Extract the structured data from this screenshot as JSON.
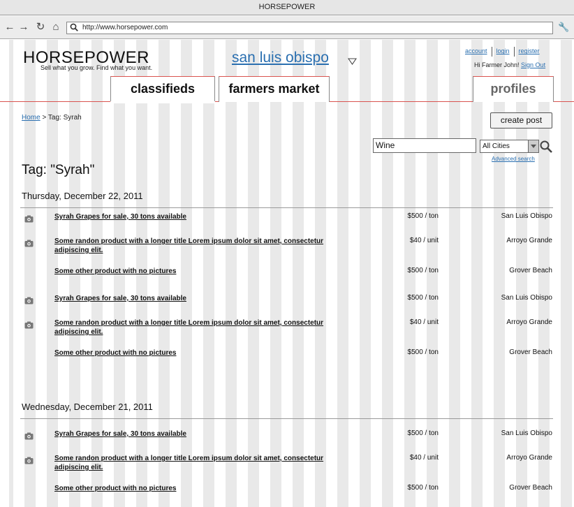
{
  "window": {
    "title": "HORSEPOWER"
  },
  "browser": {
    "url": "http://www.horsepower.com"
  },
  "site": {
    "logo": "HORSEPOWER",
    "tagline": "Sell what you grow. Find what you want.",
    "city": "san luis obispo"
  },
  "account": {
    "links": [
      "account",
      "login",
      "register"
    ],
    "greeting": "Hi Farmer John!",
    "sign_out": "Sign Out"
  },
  "tabs": [
    "classifieds",
    "farmers market",
    "profiles"
  ],
  "breadcrumb": {
    "home": "Home",
    "separator": ">",
    "current": "Tag: Syrah"
  },
  "actions": {
    "create_post": "create post"
  },
  "search": {
    "query": "Wine",
    "city_filter": "All Cities",
    "advanced": "Advanced search"
  },
  "page_title": "Tag: \"Syrah\"",
  "groups": [
    {
      "date": "Thursday, December 22, 2011",
      "items": [
        {
          "title": "Syrah Grapes for sale, 30 tons available",
          "price": "$500 / ton",
          "location": "San Luis Obispo",
          "has_photo": true
        },
        {
          "title": "Some randon product with a longer title Lorem ipsum dolor sit amet, consectetur adipiscing elit.",
          "price": "$40 / unit",
          "location": "Arroyo Grande",
          "has_photo": true
        },
        {
          "title": "Some other product with no pictures",
          "price": "$500 / ton",
          "location": "Grover Beach",
          "has_photo": false
        },
        {
          "title": "Syrah Grapes for sale, 30 tons available",
          "price": "$500 / ton",
          "location": "San Luis Obispo",
          "has_photo": true
        },
        {
          "title": "Some randon product with a longer title Lorem ipsum dolor sit amet, consectetur adipiscing elit.",
          "price": "$40 / unit",
          "location": "Arroyo Grande",
          "has_photo": true
        },
        {
          "title": "Some other product with no pictures",
          "price": "$500 / ton",
          "location": "Grover Beach",
          "has_photo": false
        }
      ]
    },
    {
      "date": "Wednesday, December 21, 2011",
      "items": [
        {
          "title": "Syrah Grapes for sale, 30 tons available",
          "price": "$500 / ton",
          "location": "San Luis Obispo",
          "has_photo": true
        },
        {
          "title": "Some randon product with a longer title Lorem ipsum dolor sit amet, consectetur adipiscing elit.",
          "price": "$40 / unit",
          "location": "Arroyo Grande",
          "has_photo": true
        },
        {
          "title": "Some other product with no pictures",
          "price": "$500 / ton",
          "location": "Grover Beach",
          "has_photo": false
        }
      ]
    }
  ],
  "colors": {
    "link": "#2a6fb0",
    "accent_line": "#d9534f",
    "column_stripe": "#e9e9e9"
  },
  "icons": [
    "back-icon",
    "forward-icon",
    "reload-icon",
    "home-icon",
    "search-icon",
    "wrench-icon",
    "dropdown-caret-icon",
    "camera-icon"
  ]
}
